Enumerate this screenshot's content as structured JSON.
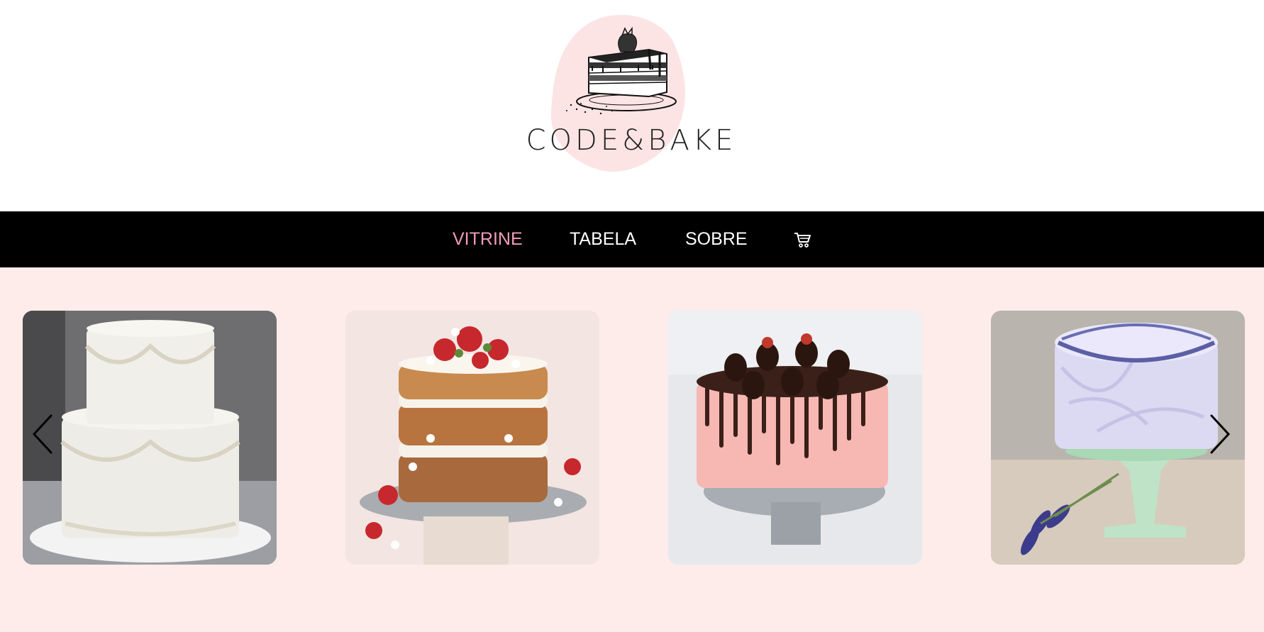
{
  "brand": {
    "name": "CODE&BAKE",
    "logo_icon": "cake-slice-icon",
    "accent_blob_color": "#fce4e4"
  },
  "nav": {
    "items": [
      {
        "label": "VITRINE",
        "active": true
      },
      {
        "label": "TABELA",
        "active": false
      },
      {
        "label": "SOBRE",
        "active": false
      }
    ],
    "cart_icon": "cart-icon",
    "active_color": "#f19cbc"
  },
  "carousel": {
    "prev_icon": "chevron-left-icon",
    "next_icon": "chevron-right-icon",
    "items": [
      {
        "image": "white-two-tier-cake"
      },
      {
        "image": "strawberry-naked-cake"
      },
      {
        "image": "pink-chocolate-drip-cake"
      },
      {
        "image": "lavender-cake"
      }
    ]
  },
  "colors": {
    "header_bg": "#ffffff",
    "nav_bg": "#000000",
    "page_bg": "#fdecea"
  }
}
